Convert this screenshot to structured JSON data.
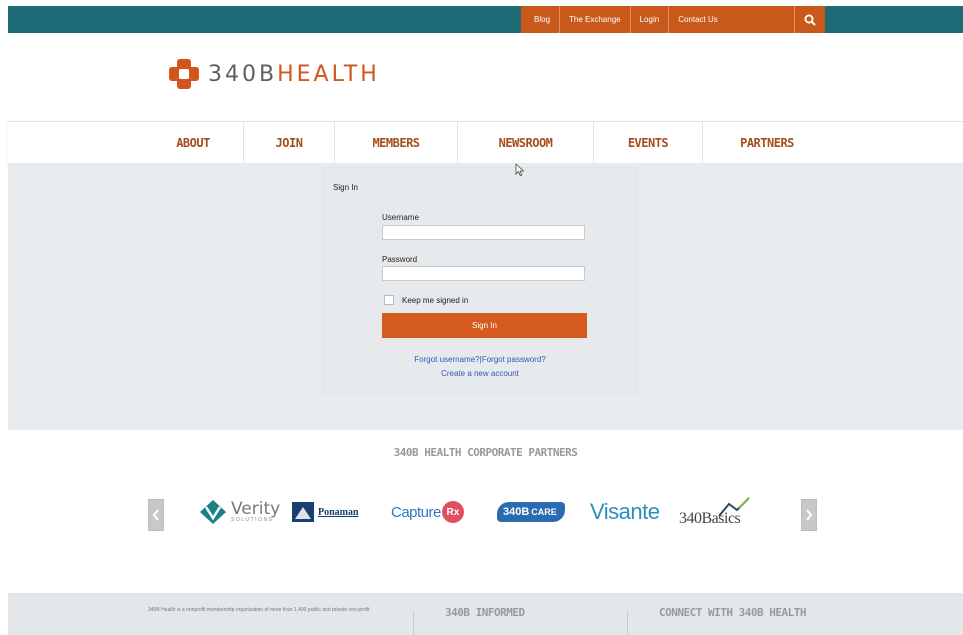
{
  "topbar": {
    "links": [
      "Blog",
      "The Exchange",
      "Login",
      "Contact Us"
    ],
    "search_icon": "search-icon",
    "colors": {
      "bar": "#1e6b78",
      "utility": "#c8591b"
    }
  },
  "brand": {
    "logo_prefix": "340B",
    "logo_suffix": "HEALTH",
    "logo_icon": "cross-logo-icon",
    "accent": "#d1561e"
  },
  "nav": {
    "items": [
      "ABOUT",
      "JOIN",
      "MEMBERS",
      "NEWSROOM",
      "EVENTS",
      "PARTNERS"
    ]
  },
  "signin": {
    "title": "Sign In",
    "username_label": "Username",
    "username_value": "",
    "password_label": "Password",
    "password_value": "",
    "keep_signed_in": "Keep me signed in",
    "button": "Sign In",
    "forgot_username": "Forgot username?",
    "separator": "|",
    "forgot_password": "Forgot password?",
    "create_account": "Create a new account"
  },
  "partners": {
    "title": "340B HEALTH CORPORATE PARTNERS",
    "items": [
      {
        "name": "Verity",
        "sub": "SOLUTIONS"
      },
      {
        "name": "Ponaman"
      },
      {
        "name": "Capture",
        "suffix": "Rx"
      },
      {
        "name": "340B",
        "suffix": "CARE"
      },
      {
        "name": "Visante"
      },
      {
        "name": "340Basics"
      }
    ],
    "prev_icon": "chevron-left-icon",
    "next_icon": "chevron-right-icon"
  },
  "footer": {
    "about_text": "340B Health is a nonprofit membership organization of more than 1,400 public and private non-profit",
    "col2_title": "340B INFORMED",
    "col3_title": "CONNECT WITH 340B HEALTH"
  }
}
